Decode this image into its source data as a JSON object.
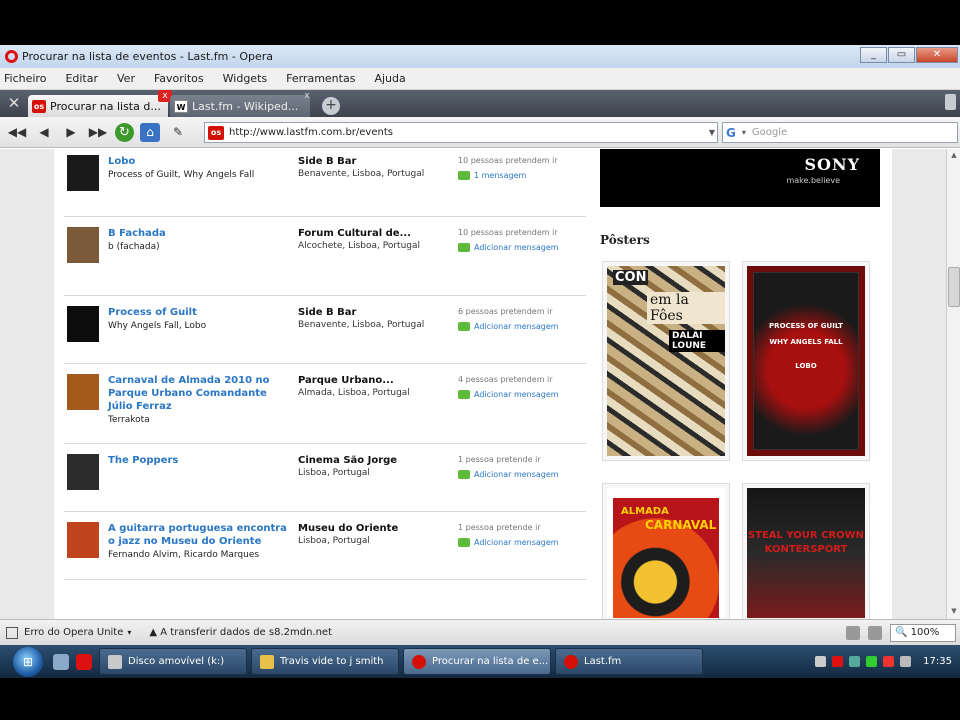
{
  "window": {
    "title": "Procurar na lista de eventos - Last.fm - Opera",
    "controls": [
      "_",
      "▭",
      "✕"
    ]
  },
  "menu": [
    "Ficheiro",
    "Editar",
    "Ver",
    "Favoritos",
    "Widgets",
    "Ferramentas",
    "Ajuda"
  ],
  "tabs": [
    {
      "label": "Procurar na lista d...",
      "favicon": "lastfm-icon",
      "active": true
    },
    {
      "label": "Last.fm - Wikiped...",
      "favicon": "wikipedia-icon",
      "active": false
    }
  ],
  "address": {
    "url": "http://www.lastfm.com.br/events",
    "search_placeholder": "Google"
  },
  "events": [
    {
      "name": "Lobo",
      "artists": "Process of Guilt, Why Angels Fall",
      "venue": "Side B Bar",
      "location": "Benavente, Lisboa, Portugal",
      "attendance": "10 pessoas pretendem ir",
      "message": "1 mensagem",
      "thumb": "#1a1a1a"
    },
    {
      "name": "B Fachada",
      "artists": "b (fachada)",
      "venue": "Forum Cultural de...",
      "location": "Alcochete, Lisboa, Portugal",
      "attendance": "10 pessoas pretendem ir",
      "message": "Adicionar mensagem",
      "thumb": "#7b5a3c"
    },
    {
      "name": "Process of Guilt",
      "artists": "Why Angels Fall, Lobo",
      "venue": "Side B Bar",
      "location": "Benavente, Lisboa, Portugal",
      "attendance": "6 pessoas pretendem ir",
      "message": "Adicionar mensagem",
      "thumb": "#0d0d0d"
    },
    {
      "name": "Carnaval de Almada 2010 no Parque Urbano Comandante Júlio Ferraz",
      "artists": "Terrakota",
      "venue": "Parque Urbano...",
      "location": "Almada, Lisboa, Portugal",
      "attendance": "4 pessoas pretendem ir",
      "message": "Adicionar mensagem",
      "thumb": "#a35a1c"
    },
    {
      "name": "The Poppers",
      "artists": "",
      "venue": "Cinema São Jorge",
      "location": "Lisboa, Portugal",
      "attendance": "1 pessoa pretende ir",
      "message": "Adicionar mensagem",
      "thumb": "#2c2c2c"
    },
    {
      "name": "A guitarra portuguesa encontra o jazz no Museu do Oriente",
      "artists": "Fernando Alvim, Ricardo Marques",
      "venue": "Museu do Oriente",
      "location": "Lisboa, Portugal",
      "attendance": "1 pessoa pretende ir",
      "message": "Adicionar mensagem",
      "thumb": "#c0451f"
    }
  ],
  "sidebar": {
    "ad_brand": "SONY",
    "ad_tagline": "make.believe",
    "posters_title": "Pôsters",
    "poster1": {
      "line1": "CON",
      "line2": "em la Fôes",
      "line3": "DALAI LOUNE"
    },
    "poster2": {
      "line1": "PROCESS OF GUILT",
      "line2": "WHY ANGELS FALL",
      "line3": "LOBO"
    },
    "poster3": {
      "line1": "ALMADA",
      "line2": "CARNAVAL"
    },
    "poster4": {
      "line1": "STEAL YOUR CROWN",
      "line2": "KONTERSPORT"
    }
  },
  "status": {
    "unite": "Erro do Opera Unite",
    "transfer": "A transferir dados de s8.2mdn.net",
    "zoom": "100%"
  },
  "taskbar": {
    "start": "⊞",
    "tasks": [
      {
        "label": "Disco amovível (k:)",
        "color": "#c9c9c9",
        "active": false
      },
      {
        "label": "Travis vide to j smith",
        "color": "#e8c14a",
        "active": false
      },
      {
        "label": "Procurar na lista de e...",
        "color": "#d51007",
        "active": true
      },
      {
        "label": "Last.fm",
        "color": "#d51007",
        "active": false
      }
    ],
    "clock": "17:35"
  }
}
